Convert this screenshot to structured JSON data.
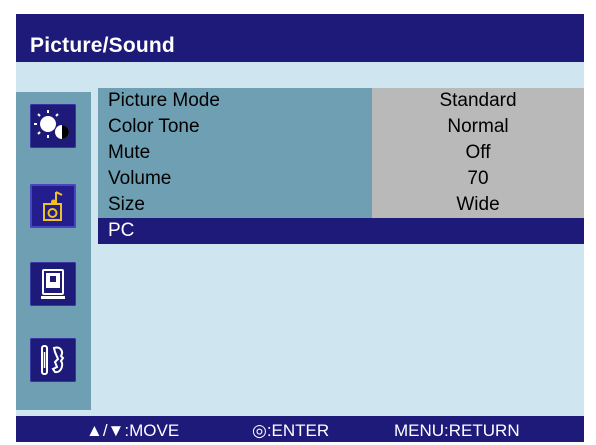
{
  "header": {
    "title": "Picture/Sound"
  },
  "sidebar": {
    "items": [
      {
        "icon": "picture-brightness-icon",
        "selected": false
      },
      {
        "icon": "sound-music-icon",
        "selected": true
      },
      {
        "icon": "display-screen-icon",
        "selected": false
      },
      {
        "icon": "tools-setup-icon",
        "selected": false
      }
    ]
  },
  "menu": {
    "rows": [
      {
        "label": "Picture Mode",
        "value": "Standard"
      },
      {
        "label": "Color Tone",
        "value": "Normal"
      },
      {
        "label": "Mute",
        "value": "Off"
      },
      {
        "label": "Volume",
        "value": "70"
      },
      {
        "label": "Size",
        "value": "Wide"
      },
      {
        "label": "PC",
        "value": "",
        "highlighted": true
      }
    ]
  },
  "footer": {
    "move": "▲/▼:MOVE",
    "enter": "◎:ENTER",
    "return": "MENU:RETURN"
  },
  "colors": {
    "title_bar": "#1e1a7a",
    "panel_bg": "#cfe6f0",
    "label_bg": "#6e9fb3",
    "value_bg": "#b9b9b9",
    "highlight": "#1e1a7a"
  }
}
